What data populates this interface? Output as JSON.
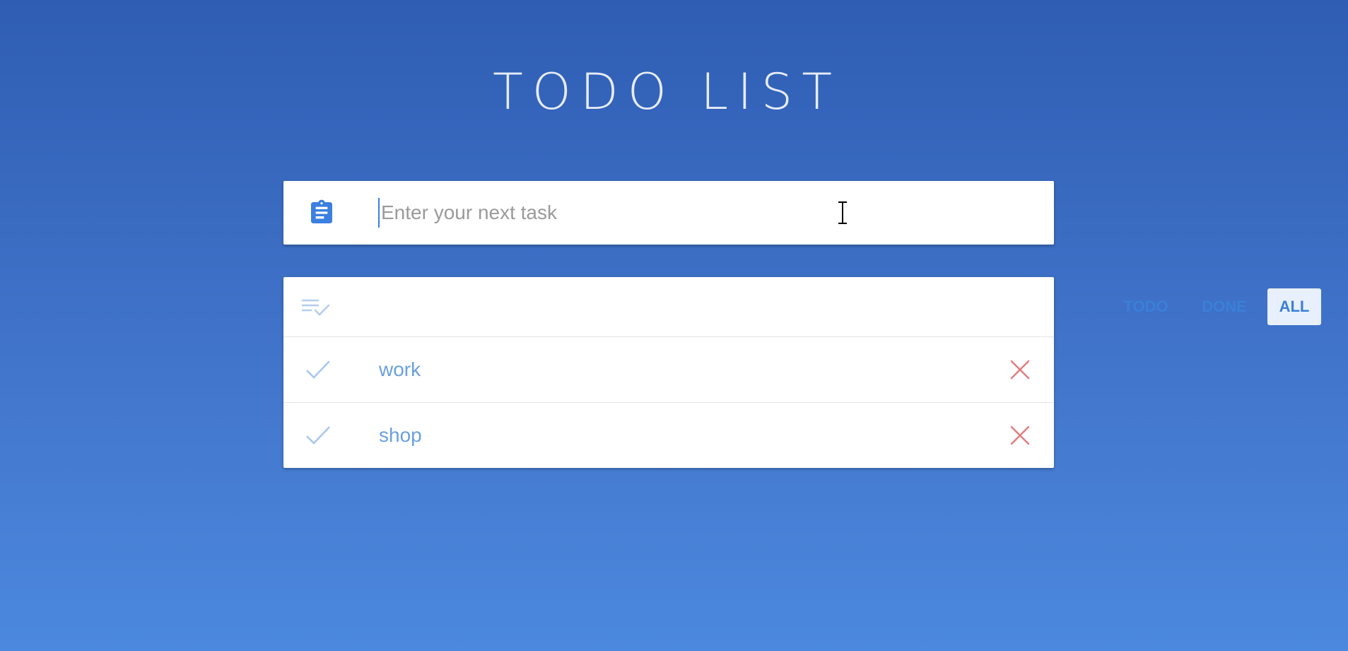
{
  "app": {
    "title": "TODO LIST"
  },
  "input": {
    "placeholder": "Enter your next task",
    "value": "",
    "icon": "clipboard-icon"
  },
  "list": {
    "header_icon": "playlist-check-icon",
    "filters": [
      {
        "label": "TODO",
        "active": false
      },
      {
        "label": "DONE",
        "active": false
      },
      {
        "label": "ALL",
        "active": true
      }
    ],
    "items": [
      {
        "text": "work",
        "check_icon": "check-icon",
        "delete_icon": "close-icon"
      },
      {
        "text": "shop",
        "check_icon": "check-icon",
        "delete_icon": "close-icon"
      }
    ]
  },
  "colors": {
    "background_top": "#2f5db4",
    "background_bottom": "#4b89de",
    "accent": "#3b7fd8",
    "item_text": "#6a9fe0",
    "check": "#a9c8ef",
    "delete": "#e07f7f",
    "active_filter_bg": "#e7f0fc"
  }
}
